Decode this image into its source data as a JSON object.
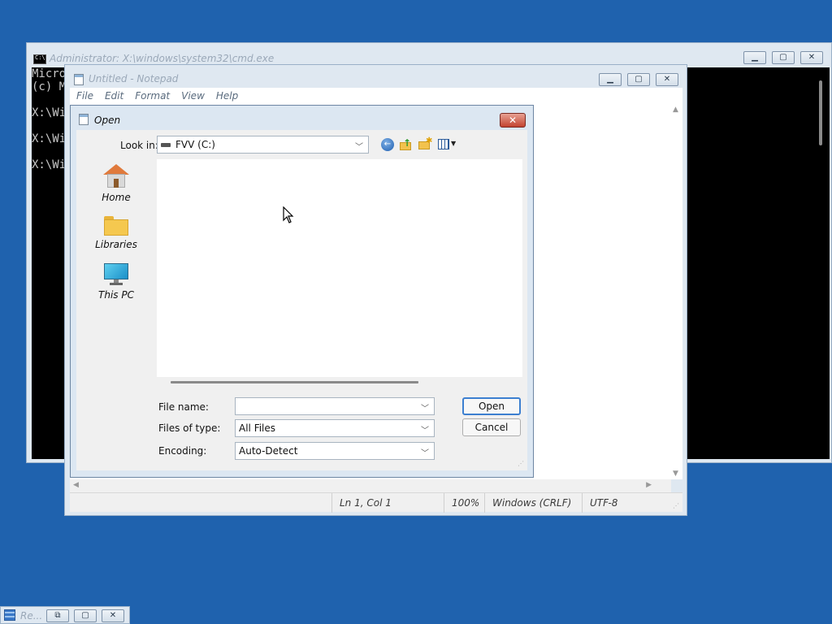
{
  "cmd": {
    "title": "Administrator: X:\\windows\\system32\\cmd.exe",
    "lines": [
      "Micro",
      "(c) M",
      "",
      "X:\\Wi",
      "",
      "X:\\Wi",
      "",
      "X:\\Wi"
    ]
  },
  "notepad": {
    "title": "Untitled - Notepad",
    "menu": [
      "File",
      "Edit",
      "Format",
      "View",
      "Help"
    ],
    "status": {
      "position": "Ln 1, Col 1",
      "zoom": "100%",
      "line_ending": "Windows (CRLF)",
      "encoding": "UTF-8"
    }
  },
  "dialog": {
    "title": "Open",
    "look_in_label": "Look in:",
    "look_in_value": "FVV (C:)",
    "places": [
      "Home",
      "Libraries",
      "This PC"
    ],
    "file_name_label": "File name:",
    "file_name_value": "",
    "files_of_type_label": "Files of type:",
    "files_of_type_value": "All Files",
    "encoding_label": "Encoding:",
    "encoding_value": "Auto-Detect",
    "open_button": "Open",
    "cancel_button": "Cancel"
  },
  "taskbar": {
    "tile_title": "Re..."
  },
  "icons": {
    "cmd": "console-icon",
    "notepad": "notepad-icon",
    "back": "back-icon",
    "up": "up-folder-icon",
    "new_folder": "new-folder-icon",
    "view": "view-menu-icon",
    "home": "home-icon",
    "libraries": "libraries-folder-icon",
    "this_pc": "monitor-icon"
  },
  "colors": {
    "desktop": "#1f62ae",
    "close_red": "#c2432f",
    "default_button_border": "#3c7fd0"
  }
}
